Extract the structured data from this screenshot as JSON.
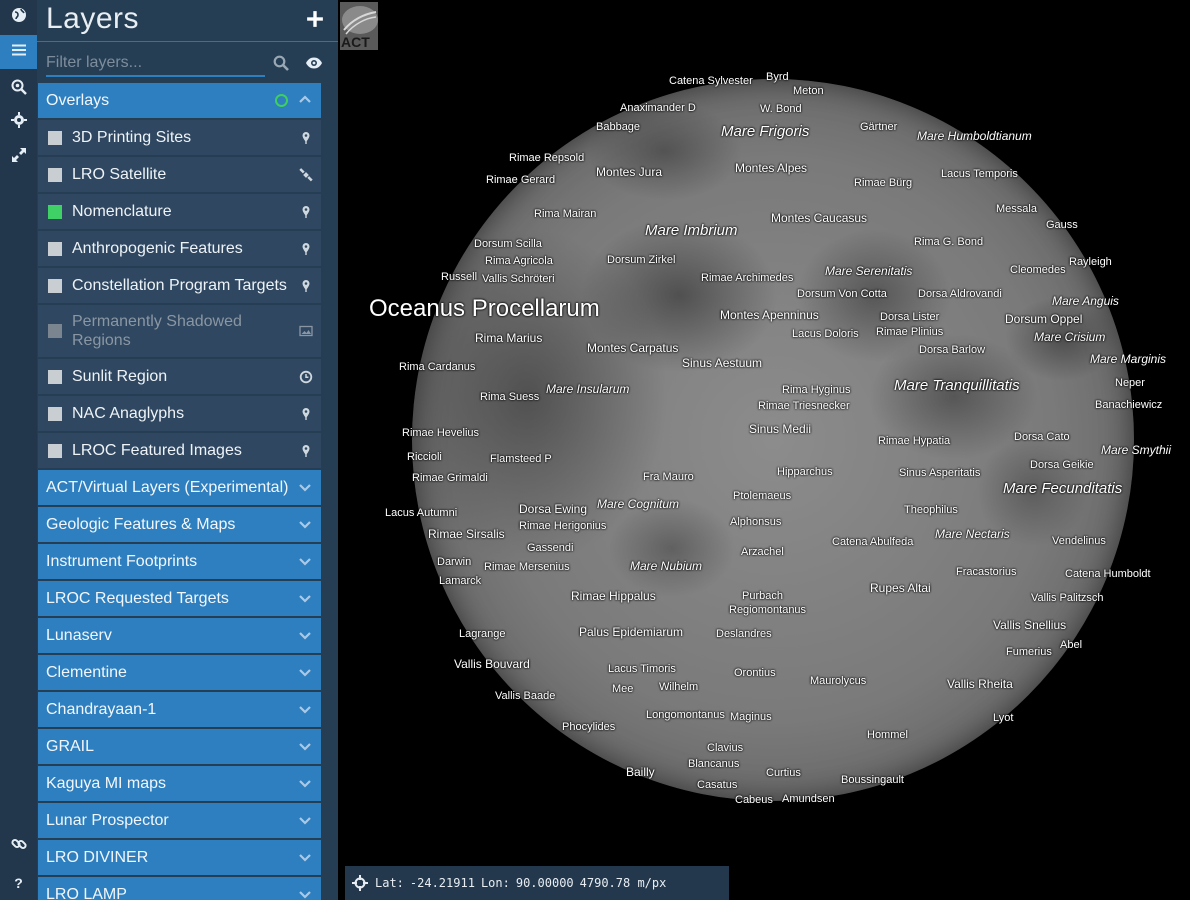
{
  "rail": {
    "items": [
      {
        "name": "globe-icon",
        "active": false
      },
      {
        "name": "layers-icon",
        "active": true
      },
      {
        "name": "identify-icon",
        "active": false
      },
      {
        "name": "settings-icon",
        "active": false
      },
      {
        "name": "expand-icon",
        "active": false
      },
      {
        "name": "link-icon",
        "active": false
      },
      {
        "name": "help-icon",
        "active": false
      }
    ]
  },
  "panel": {
    "title": "Layers",
    "filter_placeholder": "Filter layers...",
    "overlays": {
      "label": "Overlays",
      "items": [
        {
          "label": "3D Printing Sites",
          "checked": false,
          "icon": "pin-icon"
        },
        {
          "label": "LRO Satellite",
          "checked": false,
          "icon": "satellite-icon"
        },
        {
          "label": "Nomenclature",
          "checked": true,
          "icon": "pin-icon"
        },
        {
          "label": "Anthropogenic Features",
          "checked": false,
          "icon": "pin-icon"
        },
        {
          "label": "Constellation Program Targets",
          "checked": false,
          "icon": "pin-icon"
        },
        {
          "label": "Permanently Shadowed Regions",
          "checked": false,
          "disabled": true,
          "icon": "image-icon"
        },
        {
          "label": "Sunlit Region",
          "checked": false,
          "icon": "clock-icon"
        },
        {
          "label": "NAC Anaglyphs",
          "checked": false,
          "icon": "pin-icon"
        },
        {
          "label": "LROC Featured Images",
          "checked": false,
          "icon": "pin-icon"
        }
      ]
    },
    "groups": [
      "ACT/Virtual Layers (Experimental)",
      "Geologic Features & Maps",
      "Instrument Footprints",
      "LROC Requested Targets",
      "Lunaserv",
      "Clementine",
      "Chandrayaan-1",
      "GRAIL",
      "Kaguya MI maps",
      "Lunar Prospector",
      "LRO DIVINER",
      "LRO LAMP"
    ]
  },
  "map": {
    "logo_text": "ACT",
    "status": {
      "lat_label": "Lat:",
      "lat_value": "-24.21911",
      "lon_label": "Lon:",
      "lon_value": "90.00000",
      "scale": "4790.78 m/px"
    },
    "labels": [
      "Catena Sylvester",
      "Byrd",
      "Meton",
      "Anaximander D",
      "W. Bond",
      "Babbage",
      "Mare Frigoris",
      "Gärtner",
      "Mare Humboldtianum",
      "Rimae Repsold",
      "Montes Jura",
      "Montes Alpes",
      "Lacus Temporis",
      "Rimae Gerard",
      "Rimae Bürg",
      "Messala",
      "Rima Mairan",
      "Gauss",
      "Montes Caucasus",
      "Mare Imbrium",
      "Rima G. Bond",
      "Dorsum Scilla",
      "Dorsum Zirkel",
      "Rayleigh",
      "Rima Agricola",
      "Cleomedes",
      "Russell",
      "Vallis Schröteri",
      "Rimae Archimedes",
      "Mare Serenitatis",
      "Dorsum Von Cotta",
      "Dorsa Aldrovandi",
      "Mare Anguis",
      "Oceanus Procellarum",
      "Montes Apenninus",
      "Dorsa Lister",
      "Dorsum Oppel",
      "Rima Marius",
      "Lacus Doloris",
      "Rimae Plinius",
      "Mare Crisium",
      "Montes Carpatus",
      "Dorsa Barlow",
      "Mare Marginis",
      "Rima Cardanus",
      "Sinus Aestuum",
      "Neper",
      "Mare Insularum",
      "Rima Hyginus",
      "Mare Tranquillitatis",
      "Rima Suess",
      "Rimae Triesnecker",
      "Banachiewicz",
      "Rimae Hevelius",
      "Sinus Medii",
      "Rimae Hypatia",
      "Dorsa Cato",
      "Riccioli",
      "Flamsteed P",
      "Mare Smythii",
      "Dorsa Geikie",
      "Rimae Grimaldi",
      "Fra Mauro",
      "Hipparchus",
      "Sinus Asperitatis",
      "Mare Fecunditatis",
      "Ptolemaeus",
      "Dorsa Ewing",
      "Mare Cognitum",
      "Lacus Autumni",
      "Theophilus",
      "Rimae Sirsalis",
      "Rimae Herigonius",
      "Alphonsus",
      "Mare Nectaris",
      "Gassendi",
      "Catena Abulfeda",
      "Vendelinus",
      "Arzachel",
      "Darwin",
      "Rimae Mersenius",
      "Mare Nubium",
      "Fracastorius",
      "Catena Humboldt",
      "Lamarck",
      "Rupes Altai",
      "Rimae Hippalus",
      "Purbach",
      "Vallis Palitzsch",
      "Regiomontanus",
      "Vallis Snellius",
      "Lagrange",
      "Palus Epidemiarum",
      "Deslandres",
      "Fumerius",
      "Abel",
      "Vallis Bouvard",
      "Lacus Timoris",
      "Orontius",
      "Mee",
      "Wilhelm",
      "Maurolycus",
      "Vallis Rheita",
      "Vallis Baade",
      "Longomontanus",
      "Maginus",
      "Lyot",
      "Phocylides",
      "Hommel",
      "Clavius",
      "Bailly",
      "Blancanus",
      "Curtius",
      "Boussingault",
      "Casatus",
      "Cabeus",
      "Amundsen"
    ]
  }
}
